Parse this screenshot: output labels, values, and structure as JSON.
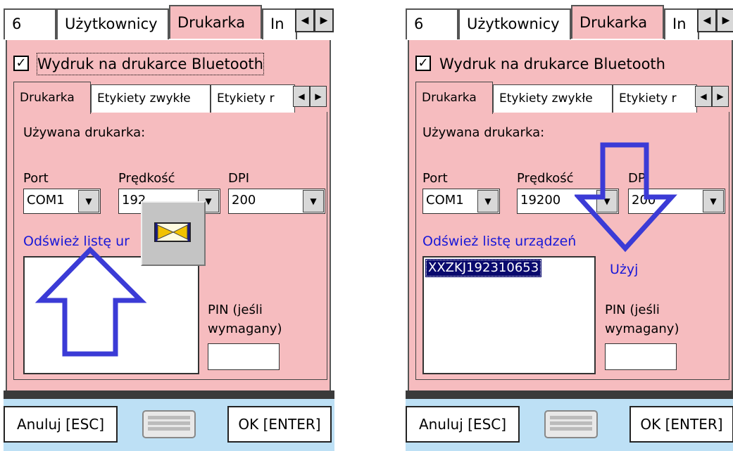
{
  "left": {
    "tabs": {
      "t6": "6",
      "users": "Użytkownicy",
      "printer": "Drukarka",
      "more": "In"
    },
    "bt_checkbox": {
      "checked": "✓",
      "label": "Wydruk na drukarce Bluetooth"
    },
    "inner_tabs": {
      "printer": "Drukarka",
      "plain_labels": "Etykiety zwykłe",
      "other_labels": "Etykiety r"
    },
    "used_printer_label": "Używana drukarka:",
    "port": {
      "label": "Port",
      "value": "COM1"
    },
    "speed": {
      "label": "Prędkość",
      "value": "192"
    },
    "dpi": {
      "label": "DPI",
      "value": "200"
    },
    "refresh_link": "Odśwież listę ur",
    "pin_label_1": "PIN (jeśli",
    "pin_label_2": "wymagany)"
  },
  "right": {
    "tabs": {
      "t6": "6",
      "users": "Użytkownicy",
      "printer": "Drukarka",
      "more": "In"
    },
    "bt_checkbox": {
      "checked": "✓",
      "label": "Wydruk na drukarce Bluetooth"
    },
    "inner_tabs": {
      "printer": "Drukarka",
      "plain_labels": "Etykiety zwykłe",
      "other_labels": "Etykiety r"
    },
    "used_printer_label": "Używana drukarka:",
    "port": {
      "label": "Port",
      "value": "COM1"
    },
    "speed": {
      "label": "Prędkość",
      "value": "19200"
    },
    "dpi": {
      "label": "DPI",
      "value": "200"
    },
    "refresh_link": "Odśwież listę urządzeń",
    "device": "XXZKJ192310653",
    "use_link": "Użyj",
    "pin_label_1": "PIN (jeśli",
    "pin_label_2": "wymagany)"
  },
  "buttons": {
    "cancel": "Anuluj [ESC]",
    "ok": "OK [ENTER]"
  },
  "arrows": {
    "left": "◀",
    "right": "▶",
    "down": "▼"
  },
  "colors": {
    "panel_pink": "#f6bcbf",
    "link_blue": "#1818d8",
    "annotation_blue": "#3b3bd6",
    "bottom_bar": "#bde0f5",
    "selection": "#0a0a6e"
  },
  "icons": [
    "hourglass-wait-icon",
    "keyboard-icon",
    "arrow-up-annotation-icon",
    "arrow-down-annotation-icon"
  ]
}
